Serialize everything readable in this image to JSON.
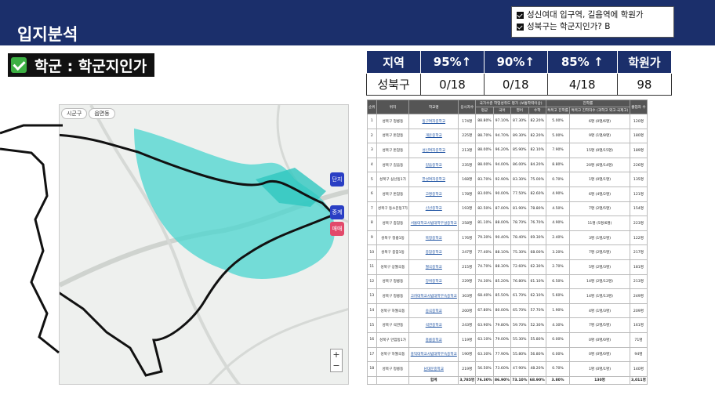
{
  "header": {
    "title": "입지분석"
  },
  "notes": [
    "성신여대 입구역, 길음역에 학원가",
    "성북구는 학군지인가? B"
  ],
  "badge": {
    "label": "학군 : 학군지인가"
  },
  "summary": {
    "headers": [
      "지역",
      "95%↑",
      "90%↑",
      "85% ↑",
      "학원가"
    ],
    "row": [
      "성북구",
      "0/18",
      "0/18",
      "4/18",
      "98"
    ]
  },
  "map": {
    "tabs": [
      "시군구",
      "읍면동"
    ],
    "controls": [
      "단지",
      "중계",
      "매매"
    ],
    "zoom_in": "+",
    "zoom_out": "−"
  },
  "detail": {
    "group_headers": {
      "score": "국가수준 학업성취도 평가 (보통학력이상)",
      "entrance": "진학률"
    },
    "headers": [
      "순위",
      "위치",
      "학교명",
      "응시자수",
      "평균",
      "국어",
      "영어",
      "수학",
      "특목고 진학률",
      "특목고 진학자수 (과학고 외고·국제고)",
      "졸업자 수"
    ],
    "rows": [
      [
        "1",
        "성북구 정릉동",
        "동구여자중학교",
        "174명",
        "88.80%",
        "97.10%",
        "87.30%",
        "82.20%",
        "5.00%",
        "6명 (0명/6명)",
        "120명"
      ],
      [
        "2",
        "성북구 돈암동",
        "개운중학교",
        "225명",
        "88.70%",
        "94.70%",
        "89.30%",
        "82.20%",
        "5.00%",
        "9명 (1명/8명)",
        "180명"
      ],
      [
        "3",
        "성북구 돈암동",
        "성신여자중학교",
        "213명",
        "88.00%",
        "96.20%",
        "85.90%",
        "82.10%",
        "7.90%",
        "15명 (0명/15명)",
        "189명"
      ],
      [
        "4",
        "성북구 길음동",
        "길음중학교",
        "235명",
        "88.00%",
        "94.00%",
        "86.00%",
        "84.20%",
        "8.80%",
        "20명 (6명/14명)",
        "226명"
      ],
      [
        "5",
        "성북구 삼선동1가",
        "한성여자중학교",
        "168명",
        "83.70%",
        "92.90%",
        "83.30%",
        "75.00%",
        "0.70%",
        "1명 (0명/1명)",
        "135명"
      ],
      [
        "6",
        "성북구 돈암동",
        "고명중학교",
        "178명",
        "83.00%",
        "90.00%",
        "77.50%",
        "82.60%",
        "4.90%",
        "6명 (4명/2명)",
        "121명"
      ],
      [
        "7",
        "성북구 동소문동7가",
        "신선중학교",
        "193명",
        "82.50%",
        "87.00%",
        "81.90%",
        "78.80%",
        "4.50%",
        "7명 (2명/5명)",
        "154명"
      ],
      [
        "8",
        "성북구 종암동",
        "서울대학교사범대학부설중학교",
        "258명",
        "81.10%",
        "88.00%",
        "78.70%",
        "76.70%",
        "4.90%",
        "11명 (5명/6명)",
        "223명"
      ],
      [
        "9",
        "성북구 정릉1동",
        "북정중학교",
        "176명",
        "79.30%",
        "90.40%",
        "78.40%",
        "69.30%",
        "2.40%",
        "3명 (1명/2명)",
        "122명"
      ],
      [
        "10",
        "성북구 종암1동",
        "종암중학교",
        "247명",
        "77.40%",
        "88.10%",
        "75.30%",
        "68.00%",
        "3.20%",
        "7명 (2명/5명)",
        "217명"
      ],
      [
        "11",
        "성북구 상월곡동",
        "월곡중학교",
        "215명",
        "74.70%",
        "88.30%",
        "72.60%",
        "62.30%",
        "2.70%",
        "5명 (2명/3명)",
        "181명"
      ],
      [
        "12",
        "성북구 정릉동",
        "장위중학교",
        "229명",
        "74.30%",
        "85.20%",
        "76.80%",
        "61.10%",
        "6.50%",
        "14명 (2명/12명)",
        "213명"
      ],
      [
        "13",
        "성북구 정릉동",
        "고려대학교사범대학부속중학교",
        "303명",
        "68.40%",
        "85.50%",
        "61.70%",
        "62.10%",
        "5.60%",
        "14명 (1명/13명)",
        "249명"
      ],
      [
        "14",
        "성북구 하월곡동",
        "숭곡중학교",
        "200명",
        "67.80%",
        "80.00%",
        "65.70%",
        "57.70%",
        "1.90%",
        "4명 (1명/3명)",
        "209명"
      ],
      [
        "15",
        "성북구 석관동",
        "석관중학교",
        "243명",
        "63.90%",
        "79.80%",
        "59.70%",
        "52.30%",
        "4.30%",
        "7명 (2명/5명)",
        "161명"
      ],
      [
        "16",
        "성북구 안암동1가",
        "홍릉중학교",
        "119명",
        "63.10%",
        "79.00%",
        "55.30%",
        "55.80%",
        "0.00%",
        "0명 (0명/0명)",
        "71명"
      ],
      [
        "17",
        "성북구 하월곡동",
        "홍익대학교사범대학부속중학교",
        "190명",
        "63.30%",
        "77.90%",
        "55.80%",
        "56.80%",
        "0.00%",
        "0명 (0명/0명)",
        "94명"
      ],
      [
        "18",
        "성북구 정릉동",
        "남대문중학교",
        "219명",
        "56.50%",
        "73.60%",
        "47.90%",
        "48.20%",
        "0.70%",
        "1명 (0명/1명)",
        "140명"
      ]
    ],
    "total": [
      "",
      "",
      "합계",
      "3,785명",
      "76.30%",
      "86.90%",
      "73.10%",
      "68.90%",
      "3.80%",
      "130명",
      "3,011명"
    ]
  },
  "colors": {
    "navy": "#1b2f6b",
    "map_green": "#49d6cf",
    "map_marker": "#2a3fc4",
    "check_green": "#3cb043"
  }
}
